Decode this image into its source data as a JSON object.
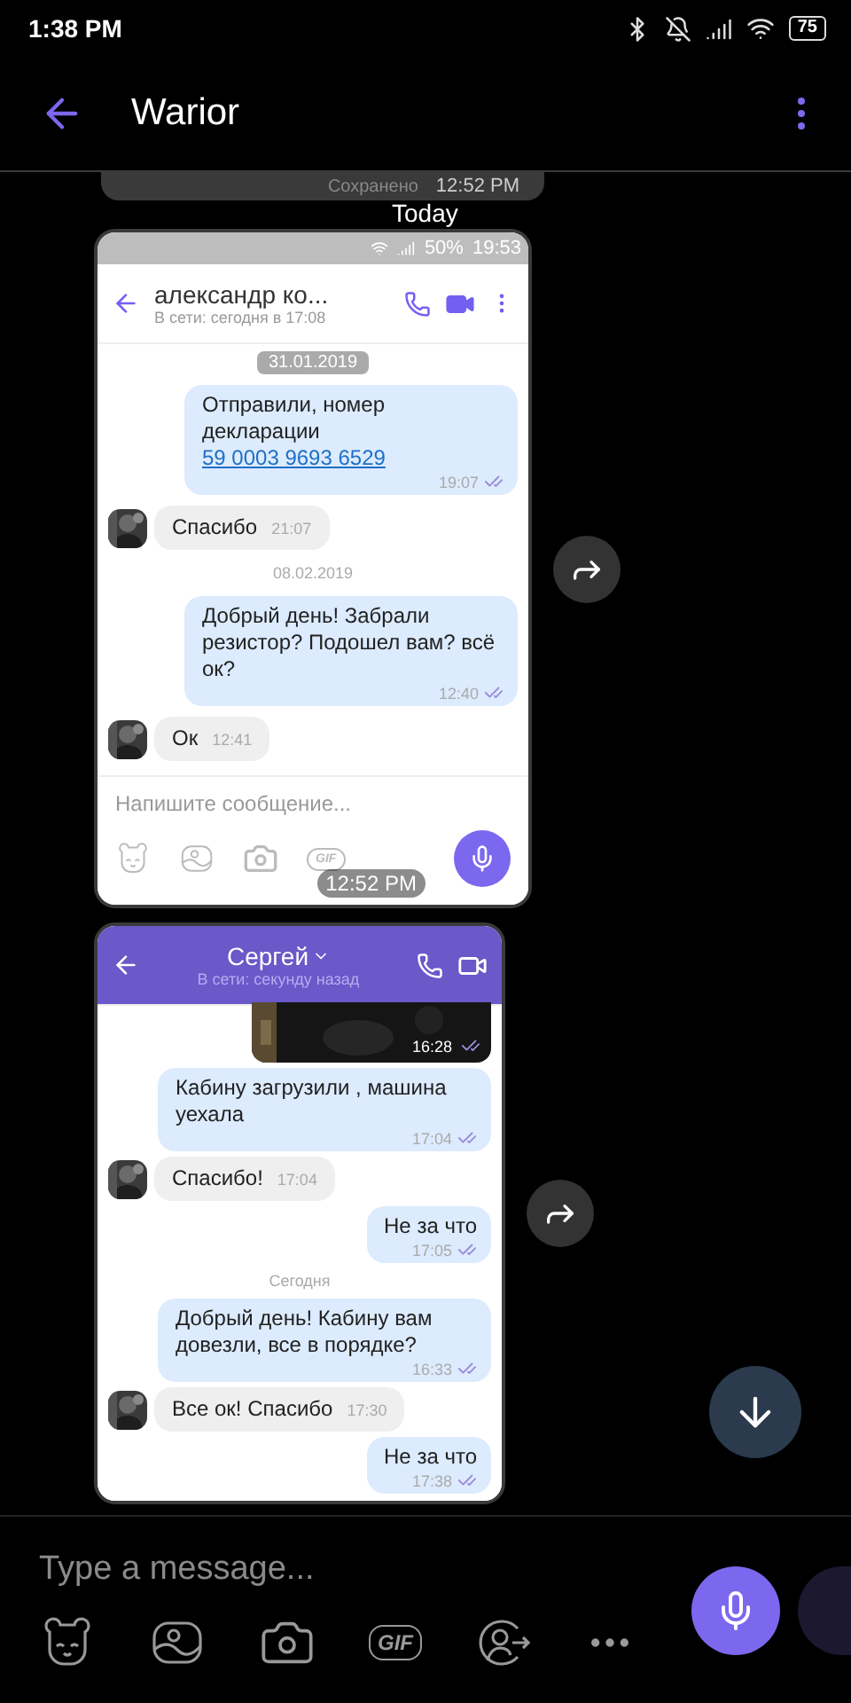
{
  "status_bar": {
    "time": "1:38 PM",
    "battery": "75"
  },
  "header": {
    "title": "Warior"
  },
  "chat": {
    "saved_bubble": {
      "label": "Сохранено",
      "time": "12:52 PM"
    },
    "day_label": "Today",
    "screenshots": [
      {
        "kind": "light",
        "time": "12:52 PM",
        "status_bar": {
          "battery": "50%",
          "time": "19:53"
        },
        "contact": {
          "name": "александр ко...",
          "status": "В сети: сегодня в 17:08"
        },
        "messages": [
          {
            "kind": "date_pill",
            "text": "31.01.2019"
          },
          {
            "kind": "out",
            "text": "Отправили, номер декларации",
            "link": "59 0003 9693 6529",
            "time": "19:07"
          },
          {
            "kind": "in",
            "text": "Спасибо",
            "time": "21:07"
          },
          {
            "kind": "date",
            "text": "08.02.2019"
          },
          {
            "kind": "out",
            "text": "Добрый день! Забрали резистор? Подошел вам? всё ок?",
            "time": "12:40"
          },
          {
            "kind": "in",
            "text": "Ок",
            "time": "12:41"
          }
        ],
        "composer": {
          "placeholder": "Напишите сообщение...",
          "gif_label": "GIF"
        }
      },
      {
        "kind": "purple",
        "contact": {
          "name": "Сергей",
          "status": "В сети: секунду назад"
        },
        "messages": [
          {
            "time": "16:28"
          },
          {
            "kind": "out",
            "text": "Кабину загрузили , машина уехала",
            "time": "17:04"
          },
          {
            "kind": "in",
            "text": "Спасибо!",
            "time": "17:04"
          },
          {
            "kind": "out",
            "text": "Не за что",
            "time": "17:05"
          },
          {
            "kind": "date",
            "text": "Сегодня"
          },
          {
            "kind": "out",
            "text": "Добрый день! Кабину вам довезли, все в порядке?",
            "time": "16:33"
          },
          {
            "kind": "in",
            "text": "Все ок! Спасибо",
            "time": "17:30"
          },
          {
            "kind": "out",
            "text": "Не за что",
            "time": "17:38"
          }
        ]
      }
    ]
  },
  "composer": {
    "placeholder": "Type a message...",
    "gif_label": "GIF"
  }
}
